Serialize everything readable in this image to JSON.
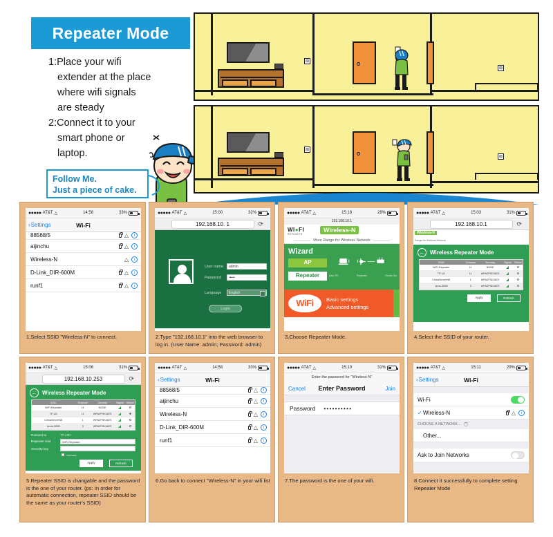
{
  "header": {
    "title": "Repeater Mode",
    "steps": [
      "1:Place your wifi",
      "extender at the place",
      "where wifi signals",
      "are steady",
      "2:Connect it to your",
      "smart phone or",
      "laptop."
    ],
    "bubble_line1": "Follow Me.",
    "bubble_line2": "Just a piece of cake.",
    "accent_blue": "#1b9ad6"
  },
  "panels": [
    {
      "id": 1,
      "caption": "1.Select SSID \"Wireless-N\" to connect.",
      "status": {
        "carrier": "AT&T",
        "time": "14:58",
        "battery": "33%"
      },
      "nav": {
        "back": "Settings",
        "title": "Wi-Fi"
      },
      "networks": [
        {
          "name": "88568/5",
          "lock": true,
          "wifi": true,
          "info": true
        },
        {
          "name": "aijinchu",
          "lock": true,
          "wifi": true,
          "info": true
        },
        {
          "name": "Wireless-N",
          "lock": false,
          "wifi": true,
          "info": true
        },
        {
          "name": "D-Link_DIR-600M",
          "lock": true,
          "wifi": true,
          "info": true
        },
        {
          "name": "runf1",
          "lock": true,
          "wifi": true,
          "info": true
        }
      ]
    },
    {
      "id": 2,
      "caption": "2.Type \"192.168.10.1\" into the web browser to log in. (User Name: admin; Password: admin)",
      "status": {
        "carrier": "AT&T",
        "time": "15:00",
        "battery": "32%"
      },
      "url": "192.168.10. 1",
      "reload_icon": "reload-icon",
      "login": {
        "username_label": "User name",
        "username_value": "admin",
        "password_label": "Password",
        "password_value": "•••••",
        "language_label": "Language",
        "language_value": "English",
        "submit_label": "Login",
        "bg_color": "#1a7040"
      }
    },
    {
      "id": 3,
      "caption": "3.Choose Repeater Mode.",
      "status": {
        "carrier": "AT&T",
        "time": "15:18",
        "battery": "28%"
      },
      "url": "192.168.10.1",
      "brand": "WIFI",
      "brand_sub": "REPEATER",
      "badge": "Wireless-N",
      "subtitle": "More Range for Wireless Network",
      "wizard_title": "Wizard",
      "btn_ap": "AP",
      "btn_repeater": "Repeater",
      "diagram_labels": [
        "User-PC",
        "Repeater",
        "Router Sw"
      ],
      "wifi_logo": "WiFi",
      "links": [
        "Basic settings",
        "Advanced settings"
      ],
      "green_color": "#3aa04f",
      "orange_color": "#f05a28"
    },
    {
      "id": 4,
      "caption": "4.Select the SSID of your router.",
      "status": {
        "carrier": "AT&T",
        "time": "15:03",
        "battery": "31%"
      },
      "url": "192.168.10.1",
      "badge": "Wireless-N",
      "subtitle": "Range for Wireless Network",
      "page_title": "Wireless Repeater Mode",
      "back_icon": "arrow-left-circle-icon",
      "table": {
        "headers": [
          "SSID",
          "Channel",
          "Security",
          "Signal",
          "Select"
        ],
        "rows": [
          {
            "ssid": "WiFi-Repeater",
            "channel": "11",
            "security": "NONE",
            "selected": false
          },
          {
            "ssid": "TP-LD",
            "channel": "11",
            "security": "WPA2PSK/AES",
            "selected": false
          },
          {
            "ssid": "ChinaServerNE",
            "channel": "1",
            "security": "WPA2PSK/AES",
            "selected": false
          },
          {
            "ssid": "Levis-300B",
            "channel": "3",
            "security": "WPA2PSK/AES",
            "selected": false
          }
        ]
      },
      "buttons": {
        "apply": "Apply",
        "refresh": "Refresh"
      }
    },
    {
      "id": 5,
      "caption": "5.Repeater SSID is changable and the password is the one of your router. (ps: In order for automatic connection, repeater SSID should be the same as your router's SSID)",
      "status": {
        "carrier": "AT&T",
        "time": "15:06",
        "battery": "31%"
      },
      "url": "192.168.10.253",
      "page_title": "Wireless Repeater Mode",
      "back_icon": "arrow-left-circle-icon",
      "table": {
        "headers": [
          "SSID",
          "Channel",
          "Security",
          "Signal",
          "Select"
        ],
        "rows": [
          {
            "ssid": "WiFi-Repeater",
            "channel": "11",
            "security": "NONE",
            "selected": false
          },
          {
            "ssid": "TP-LD",
            "channel": "11",
            "security": "WPA2PSK/AES",
            "selected": true
          },
          {
            "ssid": "ChinaServerNE",
            "channel": "1",
            "security": "WPA2PSK/AES",
            "selected": false
          },
          {
            "ssid": "Levis-300B",
            "channel": "3",
            "security": "WPA2PSK/AES",
            "selected": false
          }
        ]
      },
      "form": {
        "connect_to_label": "Connect to",
        "connect_to_value": "TP-LXD",
        "repeater_ssid_label": "Repeater ssid",
        "repeater_ssid_value": "WiFi-Repeater",
        "security_key_label": "Security key",
        "security_key_value": "",
        "unmask_label": "Unmask"
      },
      "buttons": {
        "apply": "Apply",
        "refresh": "Refresh"
      }
    },
    {
      "id": 6,
      "caption": "6.Go back to connect \"Wireless-N\" in your wifi list",
      "status": {
        "carrier": "AT&T",
        "time": "14:58",
        "battery": "33%"
      },
      "nav": {
        "back": "Settings",
        "title": "Wi-Fi"
      },
      "networks": [
        {
          "name": "88568/5",
          "lock": true,
          "wifi": true,
          "info": true
        },
        {
          "name": "aijinchu",
          "lock": true,
          "wifi": true,
          "info": true
        },
        {
          "name": "Wireless-N",
          "lock": true,
          "wifi": true,
          "info": true
        },
        {
          "name": "D-Link_DIR-600M",
          "lock": true,
          "wifi": true,
          "info": true
        },
        {
          "name": "runf1",
          "lock": true,
          "wifi": true,
          "info": true
        }
      ]
    },
    {
      "id": 7,
      "caption": "7.The password is the one of your wifi.",
      "status": {
        "carrier": "AT&T",
        "time": "15:10",
        "battery": "31%"
      },
      "prompt": "Enter the password for \"Wireless-N\"",
      "cancel": "Cancel",
      "title": "Enter Password",
      "join": "Join",
      "password_label": "Password",
      "password_value": "••••••••••"
    },
    {
      "id": 8,
      "caption": "8.Connect it successfully to complete setting Repeater Mode",
      "status": {
        "carrier": "AT&T",
        "time": "15:11",
        "battery": "29%"
      },
      "nav": {
        "back": "Settings",
        "title": "Wi-Fi"
      },
      "wifi_label": "Wi-Fi",
      "wifi_on": true,
      "connected_network": "Wireless-N",
      "choose_header": "CHOOSE A NETWORK...",
      "other_label": "Other...",
      "ask_label": "Ask to Join Networks",
      "ask_on": false
    }
  ],
  "illustration": {
    "rooms": 2,
    "wall_color": "#f9f09a",
    "door_color": "#f2913c",
    "cap_color": "#1b7fc4",
    "shirt_color": "#7ac143"
  }
}
